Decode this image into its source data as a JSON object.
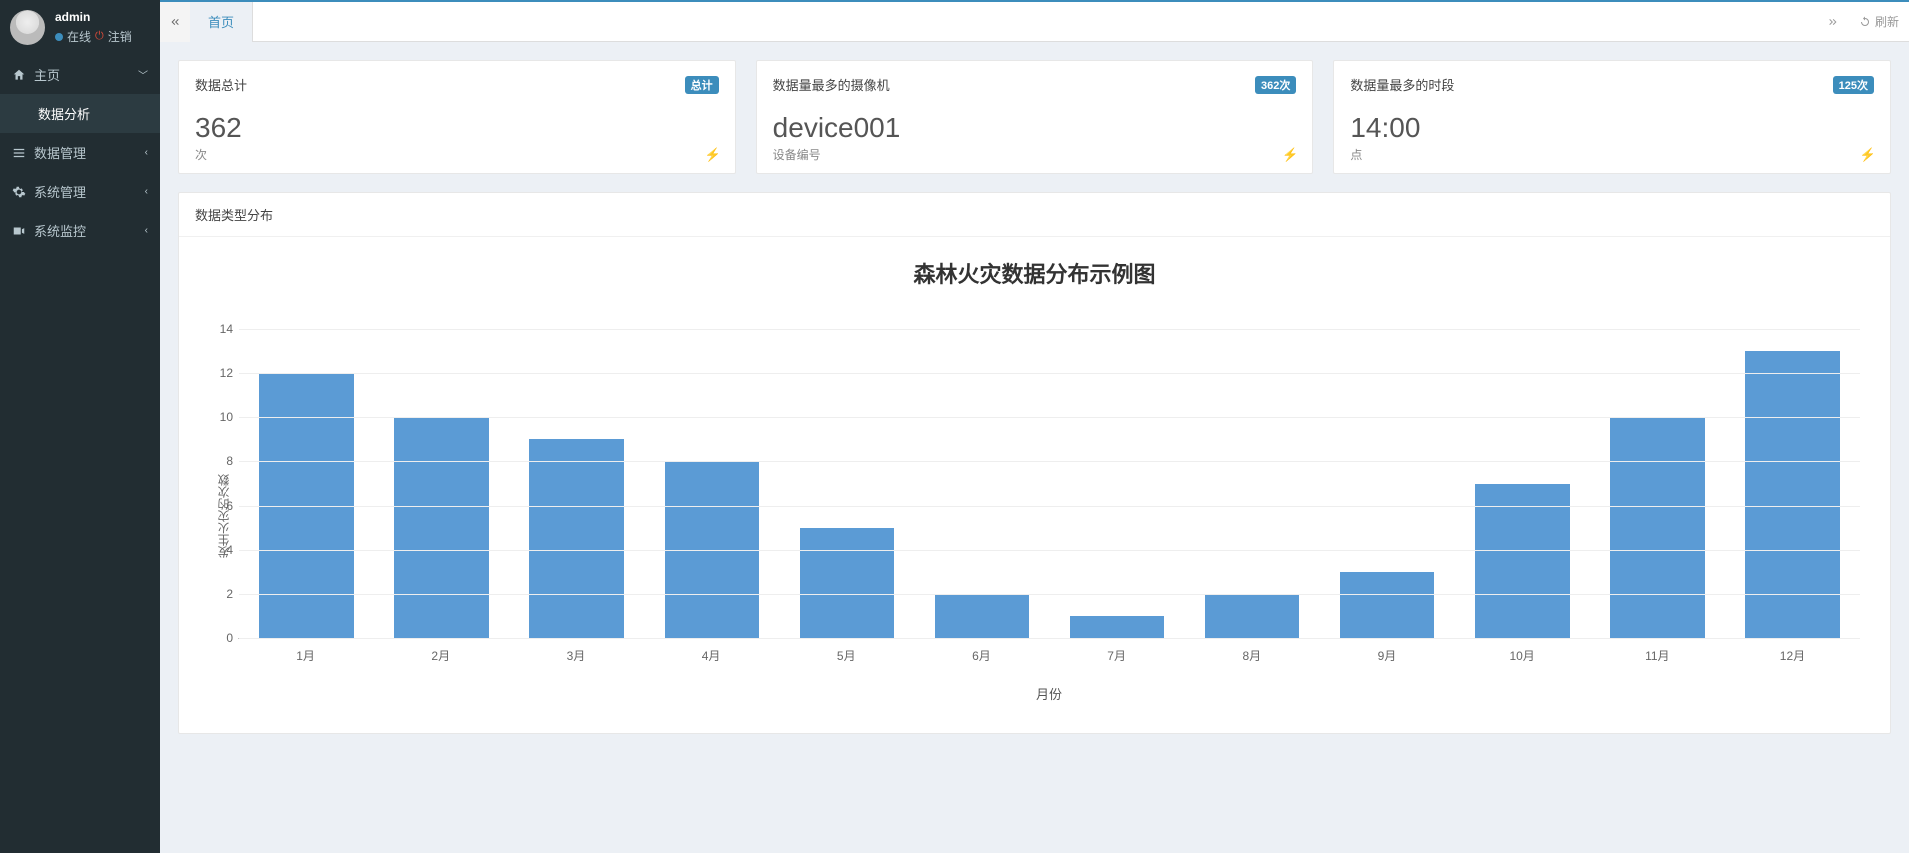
{
  "user": {
    "name": "admin",
    "online_label": "在线",
    "logout_label": "注销"
  },
  "sidebar": {
    "items": [
      {
        "icon": "home",
        "label": "主页",
        "expanded": true,
        "children": [
          {
            "label": "数据分析"
          }
        ]
      },
      {
        "icon": "list",
        "label": "数据管理",
        "expanded": false
      },
      {
        "icon": "gear",
        "label": "系统管理",
        "expanded": false
      },
      {
        "icon": "camera",
        "label": "系统监控",
        "expanded": false
      }
    ]
  },
  "tabs": {
    "active": "首页",
    "refresh_label": "刷新"
  },
  "cards": [
    {
      "title": "数据总计",
      "badge": "总计",
      "value": "362",
      "sub": "次"
    },
    {
      "title": "数据量最多的摄像机",
      "badge": "362次",
      "value": "device001",
      "sub": "设备编号"
    },
    {
      "title": "数据量最多的时段",
      "badge": "125次",
      "value": "14:00",
      "sub": "点"
    }
  ],
  "panel": {
    "title": "数据类型分布"
  },
  "chart_data": {
    "type": "bar",
    "title": "森林火灾数据分布示例图",
    "xlabel": "月份",
    "ylabel": "发生火灾的次数",
    "categories": [
      "1月",
      "2月",
      "3月",
      "4月",
      "5月",
      "6月",
      "7月",
      "8月",
      "9月",
      "10月",
      "11月",
      "12月"
    ],
    "values": [
      12,
      10,
      9,
      8,
      5,
      2,
      1,
      2,
      3,
      7,
      10,
      13
    ],
    "ylim": [
      0,
      14
    ],
    "yticks": [
      0,
      2,
      4,
      6,
      8,
      10,
      12,
      14
    ]
  }
}
